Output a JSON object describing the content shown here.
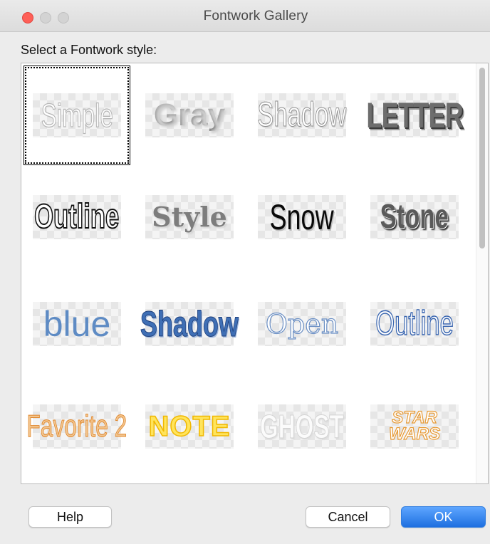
{
  "window": {
    "title": "Fontwork Gallery"
  },
  "prompt": "Select a Fontwork style:",
  "gallery": {
    "styles": [
      {
        "label": "Simple",
        "selected": true
      },
      {
        "label": "Gray",
        "selected": false
      },
      {
        "label": "Shadow",
        "selected": false
      },
      {
        "label": "LETTER",
        "selected": false
      },
      {
        "label": "Outline",
        "selected": false
      },
      {
        "label": "Style",
        "selected": false
      },
      {
        "label": "Snow",
        "selected": false
      },
      {
        "label": "Stone",
        "selected": false
      },
      {
        "label": "blue",
        "selected": false
      },
      {
        "label": "Shadow",
        "selected": false
      },
      {
        "label": "Open",
        "selected": false
      },
      {
        "label": "Outline",
        "selected": false
      },
      {
        "label": "Favorite 2",
        "selected": false
      },
      {
        "label": "NOTE",
        "selected": false
      },
      {
        "label": "GHOST",
        "selected": false
      },
      {
        "label": "STAR WARS",
        "selected": false
      }
    ]
  },
  "buttons": {
    "help": "Help",
    "cancel": "Cancel",
    "ok": "OK"
  },
  "colors": {
    "accent": "#1e6fe0",
    "close": "#fe5f57"
  }
}
